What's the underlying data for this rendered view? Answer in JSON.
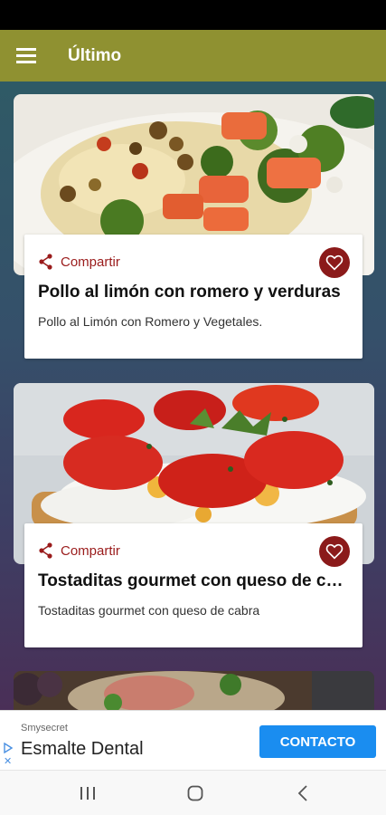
{
  "app_bar": {
    "title": "Último",
    "menu_icon": "hamburger-menu-icon",
    "background": "#8f9131"
  },
  "recipes": [
    {
      "share_label": "Compartir",
      "title": "Pollo al limón con romero y verduras",
      "description": "Pollo al Limón con Romero y Vegetales."
    },
    {
      "share_label": "Compartir",
      "title": "Tostaditas gourmet con queso de cabra",
      "description": "Tostaditas gourmet con queso de cabra"
    }
  ],
  "ad": {
    "advertiser": "Smysecret",
    "headline": "Esmalte Dental",
    "cta_label": "CONTACTO",
    "cta_color": "#1a8df0"
  },
  "colors": {
    "accent": "#8b1a1a",
    "share_text": "#9a1b1b"
  }
}
